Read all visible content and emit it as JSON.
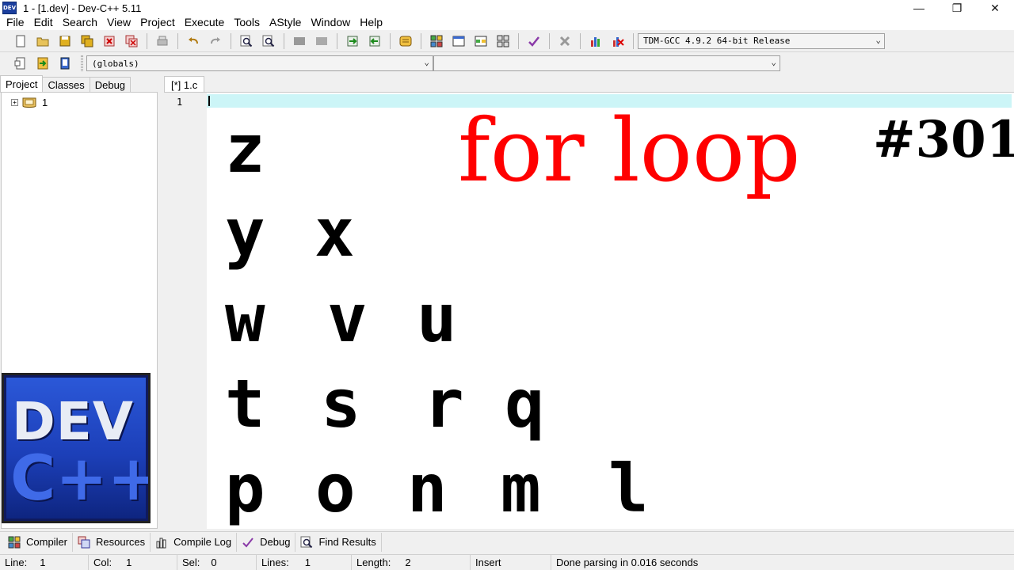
{
  "window": {
    "title": "1 - [1.dev] - Dev-C++ 5.11",
    "icon_text": "DEV",
    "controls": {
      "minimize": "—",
      "restore": "❐",
      "close": "✕"
    }
  },
  "menu": [
    "File",
    "Edit",
    "Search",
    "View",
    "Project",
    "Execute",
    "Tools",
    "AStyle",
    "Window",
    "Help"
  ],
  "toolbar": {
    "compiler_select": "TDM-GCC 4.9.2 64-bit Release",
    "scope_select": "(globals)",
    "member_select": ""
  },
  "left_panel": {
    "tabs": [
      "Project",
      "Classes",
      "Debug"
    ],
    "active_tab": "Project",
    "tree_root": "1"
  },
  "logo": {
    "line1": "DEV",
    "line2": "C++"
  },
  "editor": {
    "tab_label": "[*] 1.c",
    "line_number": "1"
  },
  "overlay": {
    "title": "for loop",
    "episode": "#301",
    "letters": [
      [
        "z"
      ],
      [
        "y",
        "x"
      ],
      [
        "w",
        "v",
        "u"
      ],
      [
        "t",
        "s",
        "r",
        "q"
      ],
      [
        "p",
        "o",
        "n",
        "m",
        "l"
      ]
    ]
  },
  "bottom_tabs": [
    "Compiler",
    "Resources",
    "Compile Log",
    "Debug",
    "Find Results"
  ],
  "status": {
    "line_label": "Line:",
    "line_value": "1",
    "col_label": "Col:",
    "col_value": "1",
    "sel_label": "Sel:",
    "sel_value": "0",
    "lines_label": "Lines:",
    "lines_value": "1",
    "length_label": "Length:",
    "length_value": "2",
    "mode": "Insert",
    "message": "Done parsing in 0.016 seconds"
  },
  "colors": {
    "overlay_title": "#ff0000",
    "current_line": "#ccf5f7",
    "logo_blue": "#1c3fb8"
  }
}
